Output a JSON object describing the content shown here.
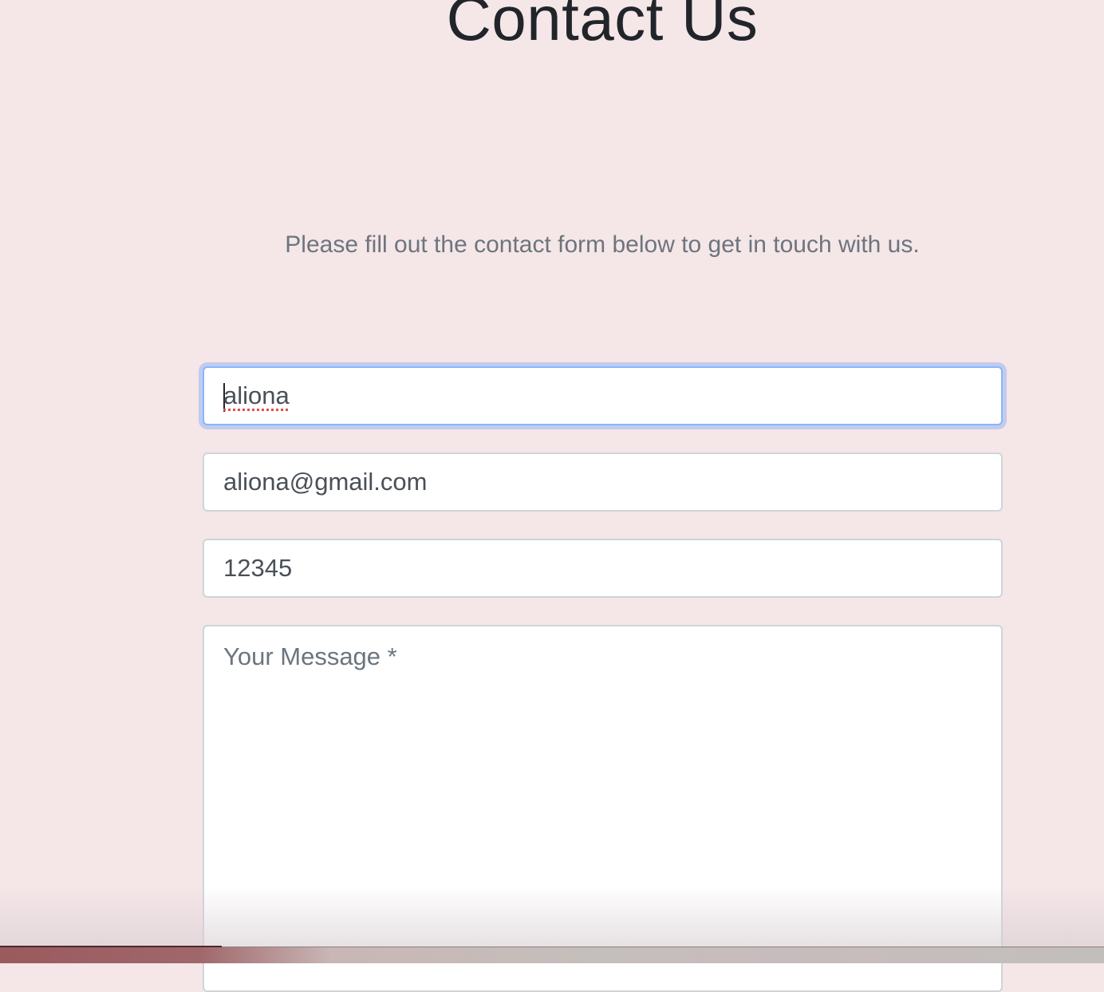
{
  "page": {
    "title": "Contact Us",
    "subtitle": "Please fill out the contact form below to get in touch with us."
  },
  "form": {
    "name_value": "aliona",
    "email_value": "aliona@gmail.com",
    "phone_value": "12345",
    "message_placeholder": "Your Message *"
  },
  "colors": {
    "background": "#f5e6e8",
    "focus_border": "#86b7fe",
    "text_dark": "#212529",
    "text_muted": "#6c757d"
  }
}
